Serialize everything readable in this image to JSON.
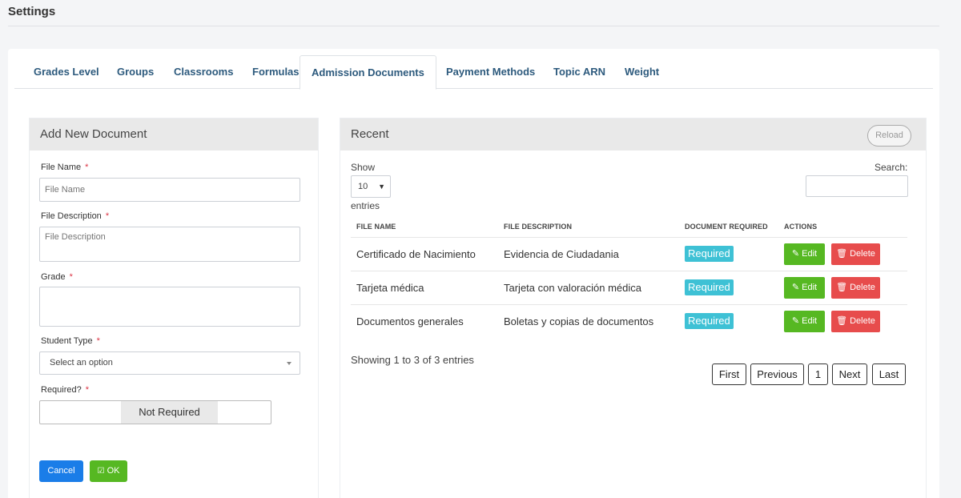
{
  "page": {
    "title": "Settings"
  },
  "tabs": [
    {
      "label": "Grades Level"
    },
    {
      "label": "Groups"
    },
    {
      "label": "Classrooms"
    },
    {
      "label": "Formulas"
    },
    {
      "label": "Admission Documents"
    },
    {
      "label": "Payment Methods"
    },
    {
      "label": "Topic ARN"
    },
    {
      "label": "Weight"
    }
  ],
  "form": {
    "heading": "Add New Document",
    "file_name_label": "File Name",
    "file_name_placeholder": "File Name",
    "file_desc_label": "File Description",
    "file_desc_placeholder": "File Description",
    "grade_label": "Grade",
    "student_type_label": "Student Type",
    "student_type_value": "Select an option",
    "required_label": "Required?",
    "required_value": "Not Required",
    "required_marker": "*",
    "cancel_label": "Cancel",
    "ok_label": "OK"
  },
  "recent": {
    "heading": "Recent",
    "reload_label": "Reload",
    "show_label": "Show",
    "show_value": "10",
    "entries_label": "entries",
    "search_label": "Search:",
    "columns": [
      "FILE NAME",
      "FILE DESCRIPTION",
      "DOCUMENT REQUIRED",
      "ACTIONS"
    ],
    "rows": [
      {
        "file_name": "Certificado de Nacimiento",
        "description": "Evidencia de Ciudadania",
        "required": "Required"
      },
      {
        "file_name": "Tarjeta médica",
        "description": "Tarjeta con valoración médica",
        "required": "Required"
      },
      {
        "file_name": "Documentos generales",
        "description": "Boletas y copias de documentos",
        "required": "Required"
      }
    ],
    "edit_label": "Edit",
    "delete_label": "Delete",
    "summary": "Showing 1 to 3 of 3 entries",
    "pagination": {
      "first": "First",
      "previous": "Previous",
      "page": "1",
      "next": "Next",
      "last": "Last"
    }
  },
  "colors": {
    "accent_blue": "#1a7de8",
    "accent_green": "#56b822",
    "danger": "#e74c4c",
    "badge": "#3ec1d5",
    "tab_text": "#2d5a7d"
  }
}
